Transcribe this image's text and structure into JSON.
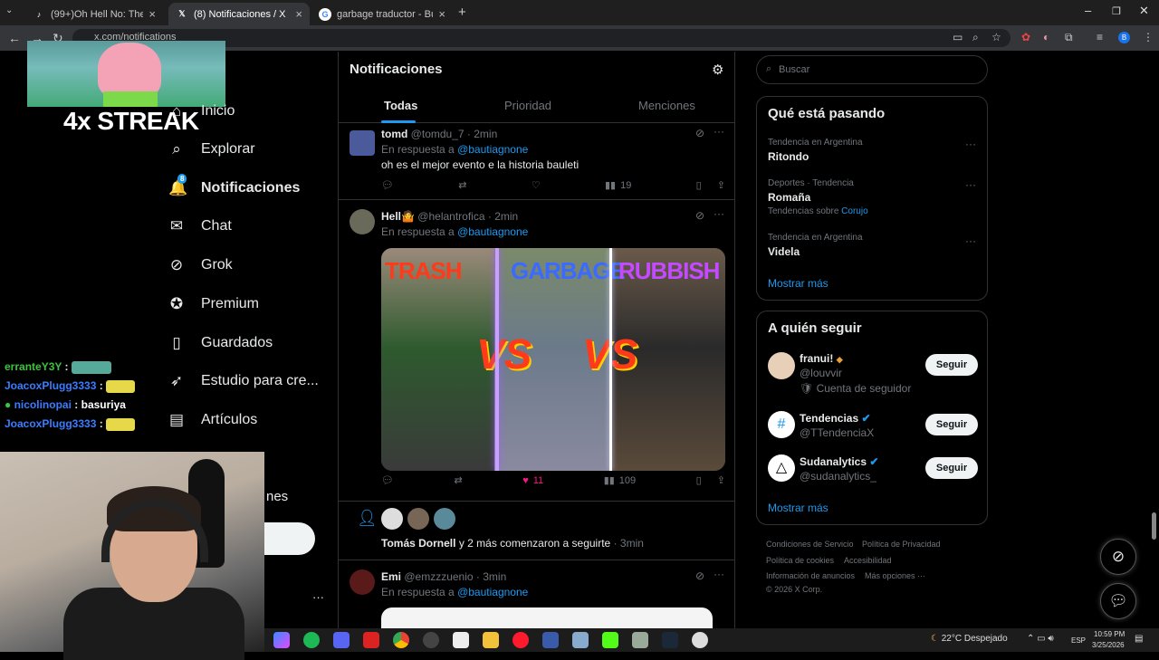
{
  "browser": {
    "tabs": [
      {
        "label": "(99+)Oh Hell No: The Ultimate",
        "icon": "tiktok-icon"
      },
      {
        "label": "(8) Notificaciones / X",
        "icon": "x-logo-icon"
      },
      {
        "label": "garbage traductor - Buscar cor",
        "icon": "google-icon"
      }
    ],
    "url": "x.com/notifications"
  },
  "stream_overlay": {
    "streak": "4x STREAK",
    "chat": [
      {
        "user": "erranteY3Y",
        "msg": "",
        "color": "#3cc43c"
      },
      {
        "user": "JoacoxPlugg3333",
        "msg": "",
        "color": "#3b7dff"
      },
      {
        "user": "nicolinopai",
        "msg": "basuriya",
        "color": "#3b7dff"
      },
      {
        "user": "JoacoxPlugg3333",
        "msg": "",
        "color": "#3b7dff"
      }
    ]
  },
  "sidebar": {
    "items": [
      {
        "label": "Inicio",
        "icon": "home-icon"
      },
      {
        "label": "Explorar",
        "icon": "search-icon"
      },
      {
        "label": "Notificaciones",
        "icon": "bell-icon",
        "badge": "8"
      },
      {
        "label": "Chat",
        "icon": "mail-icon"
      },
      {
        "label": "Grok",
        "icon": "grok-icon"
      },
      {
        "label": "Premium",
        "icon": "premium-icon"
      },
      {
        "label": "Guardados",
        "icon": "bookmark-icon"
      },
      {
        "label": "Estudio para cre...",
        "icon": "rocket-icon"
      },
      {
        "label": "Artículos",
        "icon": "article-icon"
      }
    ],
    "partial_label": "nes",
    "more": "···"
  },
  "main": {
    "title": "Notificaciones",
    "tabs": [
      "Todas",
      "Prioridad",
      "Menciones"
    ],
    "posts": [
      {
        "name": "tomd",
        "handle": "@tomdu_7",
        "time": "· 2min",
        "reply_prefix": "En respuesta a",
        "reply_to": "@bautiagnone",
        "text": "oh es el mejor evento e la historia bauleti",
        "views": "19",
        "likes": ""
      },
      {
        "name": "Hell🤷",
        "handle": "@helantrofica",
        "time": "· 2min",
        "reply_prefix": "En respuesta a",
        "reply_to": "@bautiagnone",
        "views": "109",
        "likes": "11",
        "media": {
          "words": [
            "TRASH",
            "GARBAGE",
            "RUBBISH"
          ],
          "vs": "VS"
        }
      },
      {
        "name": "Emi",
        "handle": "@emzzzuenio",
        "time": "· 3min",
        "reply_prefix": "En respuesta a",
        "reply_to": "@bautiagnone"
      }
    ],
    "follow_notice": {
      "who": "Tomás Dornell",
      "text": "y 2 más comenzaron a seguirte",
      "time": "· 3min"
    }
  },
  "right": {
    "search_placeholder": "Buscar",
    "trends": {
      "title": "Qué está pasando",
      "items": [
        {
          "context": "Tendencia en Argentina",
          "name": "Ritondo"
        },
        {
          "context": "Deportes · Tendencia",
          "name": "Romaña",
          "extra_prefix": "Tendencias sobre",
          "extra_link": "Corujo"
        },
        {
          "context": "Tendencia en Argentina",
          "name": "Videla"
        }
      ],
      "more": "Mostrar más"
    },
    "follow": {
      "title": "A quién seguir",
      "items": [
        {
          "name": "franui!",
          "handle": "@louvvir",
          "sub": "Cuenta de seguidor",
          "button": "Seguir"
        },
        {
          "name": "Tendencias",
          "handle": "@TTendenciaX",
          "button": "Seguir"
        },
        {
          "name": "Sudanalytics",
          "handle": "@sudanalytics_",
          "button": "Seguir"
        }
      ],
      "more": "Mostrar más"
    },
    "footer": [
      "Condiciones de Servicio",
      "Política de Privacidad",
      "Política de cookies",
      "Accesibilidad",
      "Información de anuncios",
      "Más opciones ···",
      "© 2026 X Corp."
    ]
  },
  "taskbar": {
    "weather": "22°C  Despejado",
    "lang": "ESP",
    "time": "10:59 PM",
    "date": "3/25/2026"
  },
  "colors": {
    "accent": "#1d9bf0",
    "like": "#f91880",
    "background": "#000000"
  }
}
